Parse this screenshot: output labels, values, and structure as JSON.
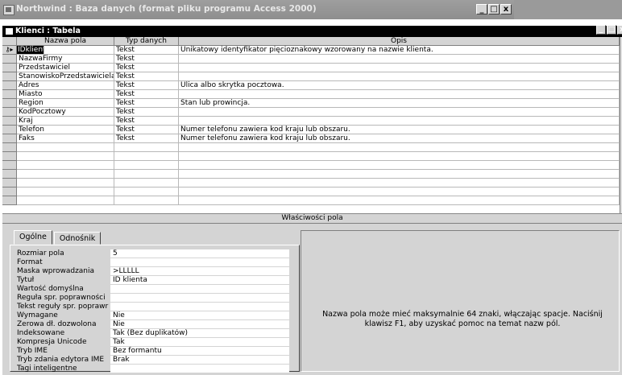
{
  "app": {
    "title": "Northwind : Baza danych (format pliku programu Access 2000)",
    "minimize": "_",
    "maximize": "□",
    "close": "x"
  },
  "table_window": {
    "title": "Klienci : Tabela",
    "minimize": "_",
    "maximize": "□",
    "close": "x"
  },
  "design_grid": {
    "headers": [
      "Nazwa pola",
      "Typ danych",
      "Opis"
    ],
    "rows": [
      {
        "name": "IDklienta",
        "type": "Tekst",
        "desc": "Unikatowy identyfikator pięcioznakowy wzorowany na nazwie klienta.",
        "key": true
      },
      {
        "name": "NazwaFirmy",
        "type": "Tekst",
        "desc": ""
      },
      {
        "name": "Przedstawiciel",
        "type": "Tekst",
        "desc": ""
      },
      {
        "name": "StanowiskoPrzedstawiciela",
        "type": "Tekst",
        "desc": ""
      },
      {
        "name": "Adres",
        "type": "Tekst",
        "desc": "Ulica albo skrytka pocztowa."
      },
      {
        "name": "Miasto",
        "type": "Tekst",
        "desc": ""
      },
      {
        "name": "Region",
        "type": "Tekst",
        "desc": "Stan lub prowincja."
      },
      {
        "name": "KodPocztowy",
        "type": "Tekst",
        "desc": ""
      },
      {
        "name": "Kraj",
        "type": "Tekst",
        "desc": ""
      },
      {
        "name": "Telefon",
        "type": "Tekst",
        "desc": "Numer telefonu zawiera kod kraju lub obszaru."
      },
      {
        "name": "Faks",
        "type": "Tekst",
        "desc": "Numer telefonu zawiera kod kraju lub obszaru."
      },
      {
        "name": "",
        "type": "",
        "desc": ""
      },
      {
        "name": "",
        "type": "",
        "desc": ""
      },
      {
        "name": "",
        "type": "",
        "desc": ""
      },
      {
        "name": "",
        "type": "",
        "desc": ""
      },
      {
        "name": "",
        "type": "",
        "desc": ""
      },
      {
        "name": "",
        "type": "",
        "desc": ""
      },
      {
        "name": "",
        "type": "",
        "desc": ""
      }
    ]
  },
  "properties_header": "Właściwości pola",
  "tabs": [
    "Ogólne",
    "Odnośnik"
  ],
  "properties": [
    {
      "label": "Rozmiar pola",
      "value": "5"
    },
    {
      "label": "Format",
      "value": ""
    },
    {
      "label": "Maska wprowadzania",
      "value": ">LLLLL"
    },
    {
      "label": "Tytuł",
      "value": "ID klienta"
    },
    {
      "label": "Wartość domyślna",
      "value": ""
    },
    {
      "label": "Reguła spr. poprawności",
      "value": ""
    },
    {
      "label": "Tekst reguły spr. poprawr",
      "value": ""
    },
    {
      "label": "Wymagane",
      "value": "Nie"
    },
    {
      "label": "Zerowa dł. dozwolona",
      "value": "Nie"
    },
    {
      "label": "Indeksowane",
      "value": "Tak (Bez duplikatów)"
    },
    {
      "label": "Kompresja Unicode",
      "value": "Tak"
    },
    {
      "label": "Tryb IME",
      "value": "Bez formantu"
    },
    {
      "label": "Tryb zdania edytora IME",
      "value": "Brak"
    },
    {
      "label": "Tagi inteligentne",
      "value": ""
    }
  ],
  "help_text": "Nazwa pola może mieć maksymalnie 64 znaki, włączając spacje. Naciśnij klawisz F1, aby uzyskać pomoc na temat nazw pól."
}
